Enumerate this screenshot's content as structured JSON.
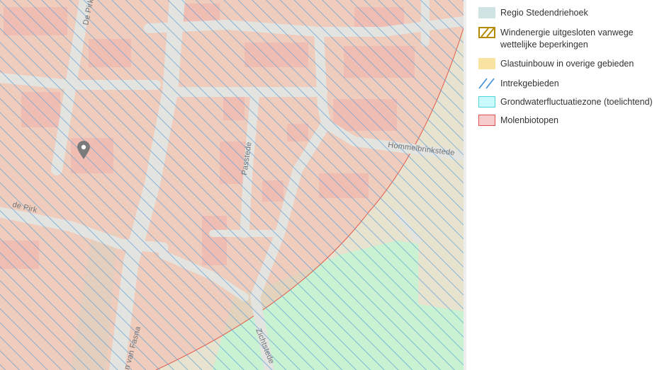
{
  "map": {
    "streets": {
      "de_pirk_north": "De Pirk",
      "de_pirk_west": "de Pirk",
      "passtede": "Passtede",
      "hommelbrinkstede": "Hommelbrinkstede",
      "van_fasna": "n van Fasna",
      "zichtstede": "Zichtstede"
    },
    "marker_icon": "map-pin-icon"
  },
  "legend": {
    "items": [
      {
        "label": "Regio Stedendriehoek",
        "swatch": "fill",
        "fill": "#cfe3e2",
        "border": "#cfe3e2"
      },
      {
        "label": "Windenergie uitgesloten vanwege wettelijke beperkingen",
        "swatch": "hatch-box",
        "fill": "#ffffff",
        "border": "#b38a00",
        "hatch": "#b38a00"
      },
      {
        "label": "Glastuinbouw in overige gebieden",
        "swatch": "fill",
        "fill": "#f9e3a3",
        "border": "#f9e3a3"
      },
      {
        "label": "Intrekgebieden",
        "swatch": "hatch-lines",
        "hatch": "#3f8fd6"
      },
      {
        "label": "Grondwaterfluctuatiezone (toelichtend)",
        "swatch": "fill",
        "fill": "#ccfbfd",
        "border": "#4fd3dc"
      },
      {
        "label": "Molenbiotopen",
        "swatch": "fill",
        "fill": "#f7cccc",
        "border": "#e35050"
      }
    ]
  },
  "colors": {
    "molen_fill": "#f3c4b8",
    "groundwater_fill": "#c8f3d4",
    "intrek_hatch": "#5a9fd8",
    "road": "#e6e6e3",
    "molen_edge": "#e35a4c"
  }
}
